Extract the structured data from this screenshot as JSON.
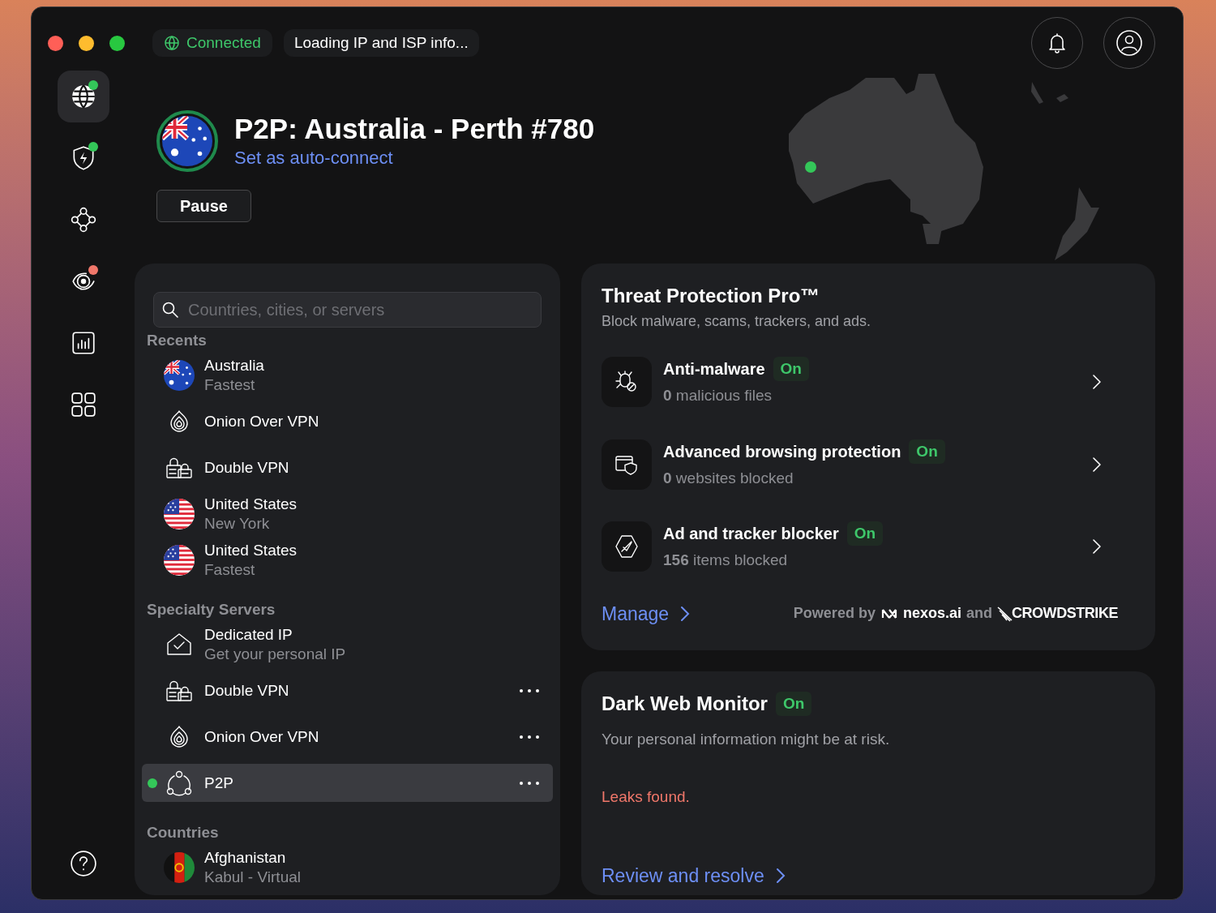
{
  "status": {
    "connection": "Connected",
    "ip_info": "Loading IP and ISP info..."
  },
  "sidebar": {
    "items": [
      {
        "kind": "globe",
        "selected": true,
        "color": "#34c759"
      },
      {
        "kind": "shield",
        "selected": false,
        "color": "#34c759"
      },
      {
        "kind": "mesh",
        "selected": false
      },
      {
        "kind": "target",
        "selected": false,
        "color": "#f0776a"
      },
      {
        "kind": "stats",
        "selected": false
      },
      {
        "kind": "apps",
        "selected": false
      }
    ]
  },
  "server": {
    "title": "P2P: Australia - Perth #780",
    "link": "Set as auto-connect",
    "pause_button": "Pause"
  },
  "search": {
    "placeholder": "Countries, cities, or servers"
  },
  "sections": [
    {
      "title": "Recents",
      "items": [
        {
          "kind": "flag-au",
          "name": "Australia",
          "detail": "Fastest",
          "has_menu": false,
          "connected": false,
          "selected": false
        },
        {
          "kind": "onion",
          "name": "Onion Over VPN",
          "has_menu": false,
          "connected": false,
          "selected": false
        },
        {
          "kind": "double",
          "name": "Double VPN",
          "has_menu": false,
          "connected": false,
          "selected": false
        },
        {
          "kind": "flag-us",
          "name": "United States",
          "detail": "New York",
          "has_menu": false,
          "connected": false,
          "selected": false
        },
        {
          "kind": "flag-us",
          "name": "United States",
          "detail": "Fastest",
          "has_menu": false,
          "connected": false,
          "selected": false
        }
      ]
    },
    {
      "title": "Specialty Servers",
      "items": [
        {
          "kind": "dedicated",
          "name": "Dedicated IP",
          "detail": "Get your personal IP",
          "has_menu": false,
          "connected": false,
          "selected": false
        },
        {
          "kind": "double",
          "name": "Double VPN",
          "has_menu": true,
          "connected": false,
          "selected": false
        },
        {
          "kind": "onion",
          "name": "Onion Over VPN",
          "has_menu": true,
          "connected": false,
          "selected": false
        },
        {
          "kind": "p2p",
          "name": "P2P",
          "has_menu": true,
          "connected": true,
          "selected": true
        }
      ]
    },
    {
      "title": "Countries",
      "items": [
        {
          "kind": "flag-af",
          "name": "Afghanistan",
          "detail": "Kabul - Virtual",
          "has_menu": false,
          "connected": false,
          "selected": false
        }
      ]
    }
  ],
  "threat_protection": {
    "title": "Threat Protection Pro™",
    "subtitle": "Block malware, scams, trackers, and ads.",
    "features": [
      {
        "kind": "bug",
        "name": "Anti-malware",
        "status": "On",
        "detail": "**0** malicious files"
      },
      {
        "kind": "browser",
        "name": "Advanced browsing protection",
        "status": "On",
        "detail": "**0** websites blocked"
      },
      {
        "kind": "blocker",
        "name": "Ad and tracker blocker",
        "status": "On",
        "detail": "**156** items blocked"
      }
    ],
    "manage_link": "Manage",
    "powered_by": "Powered by",
    "partner_1": "nexos.ai",
    "joiner": "and",
    "partner_2": "CROWDSTRIKE"
  },
  "dark_web_monitor": {
    "title": "Dark Web Monitor",
    "status": "On",
    "text": "Your personal information might be at risk.",
    "alert": "Leaks found.",
    "action": "Review and resolve"
  }
}
